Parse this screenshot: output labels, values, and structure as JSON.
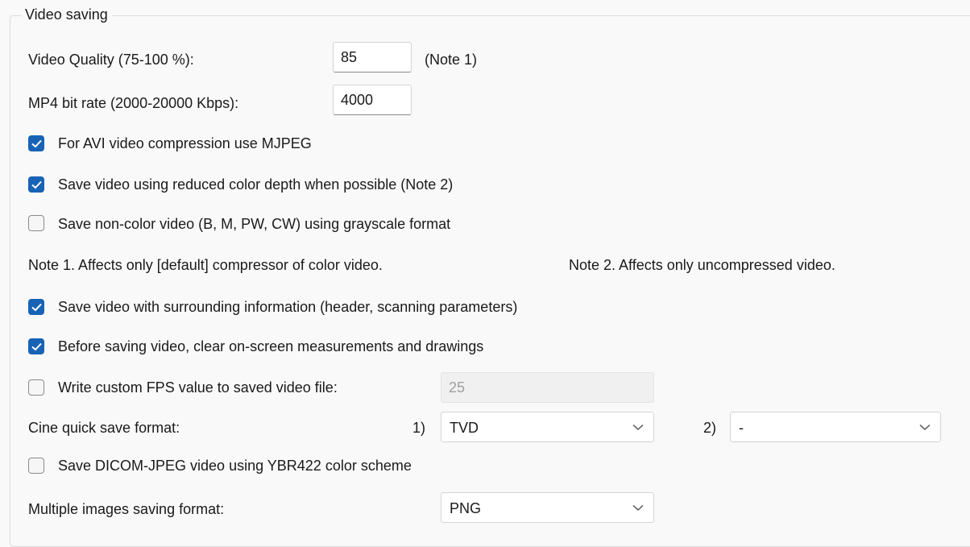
{
  "group": {
    "title": "Video saving"
  },
  "video_quality": {
    "label": "Video Quality (75-100 %):",
    "value": "85",
    "note": "(Note 1)"
  },
  "mp4_bitrate": {
    "label": "MP4 bit rate (2000-20000 Kbps):",
    "value": "4000"
  },
  "checkboxes": {
    "avi_mjpeg": {
      "label": "For AVI video compression use MJPEG",
      "checked": true
    },
    "reduced_color": {
      "label": "Save video using reduced color depth when possible (Note 2)",
      "checked": true
    },
    "grayscale": {
      "label": "Save non-color video (B, M, PW, CW) using grayscale format",
      "checked": false
    },
    "surrounding_info": {
      "label": "Save video with surrounding information (header, scanning parameters)",
      "checked": true
    },
    "clear_measurements": {
      "label": "Before saving video, clear on-screen measurements and drawings",
      "checked": true
    },
    "custom_fps": {
      "label": "Write custom FPS value to saved video file:",
      "checked": false
    },
    "dicom_ybr": {
      "label": "Save DICOM-JPEG video using YBR422 color scheme",
      "checked": false
    }
  },
  "notes": {
    "note1": "Note 1. Affects only [default] compressor of color video.",
    "note2": "Note 2. Affects only uncompressed video."
  },
  "fps_value": "25",
  "cine": {
    "label": "Cine quick save format:",
    "num1": "1)",
    "value1": "TVD",
    "num2": "2)",
    "value2": "-"
  },
  "multi_images": {
    "label": "Multiple images saving format:",
    "value": "PNG"
  },
  "colors": {
    "accent": "#1863b5",
    "background": "#f9f9f9"
  }
}
